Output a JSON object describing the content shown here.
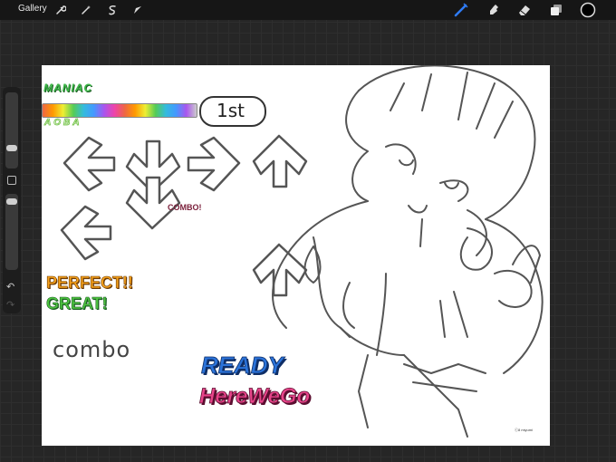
{
  "toolbar": {
    "gallery_label": "Gallery",
    "icons_left": [
      "wrench-icon",
      "magic-wand-icon",
      "selection-icon",
      "transform-arrow-icon"
    ],
    "icons_right": [
      "brush-icon",
      "smudge-icon",
      "eraser-icon",
      "layers-icon",
      "color-swatch-icon"
    ],
    "accent_color": "#2f7cf6",
    "current_color": "#000000"
  },
  "sidebar": {
    "size_slider_level": 0.25,
    "opacity_slider_level": 0.1
  },
  "canvas": {
    "difficulty": "MANIAC",
    "player_name": "AOBA",
    "rank": "1st",
    "combo_small": "COMBO!",
    "judge_perfect": "PERFECT!!",
    "judge_great": "GREAT!",
    "combo_handwritten": "combo",
    "ready": "READY",
    "here_we_go": "HereWeGo",
    "signature": "ⓒ8 miyumi"
  }
}
